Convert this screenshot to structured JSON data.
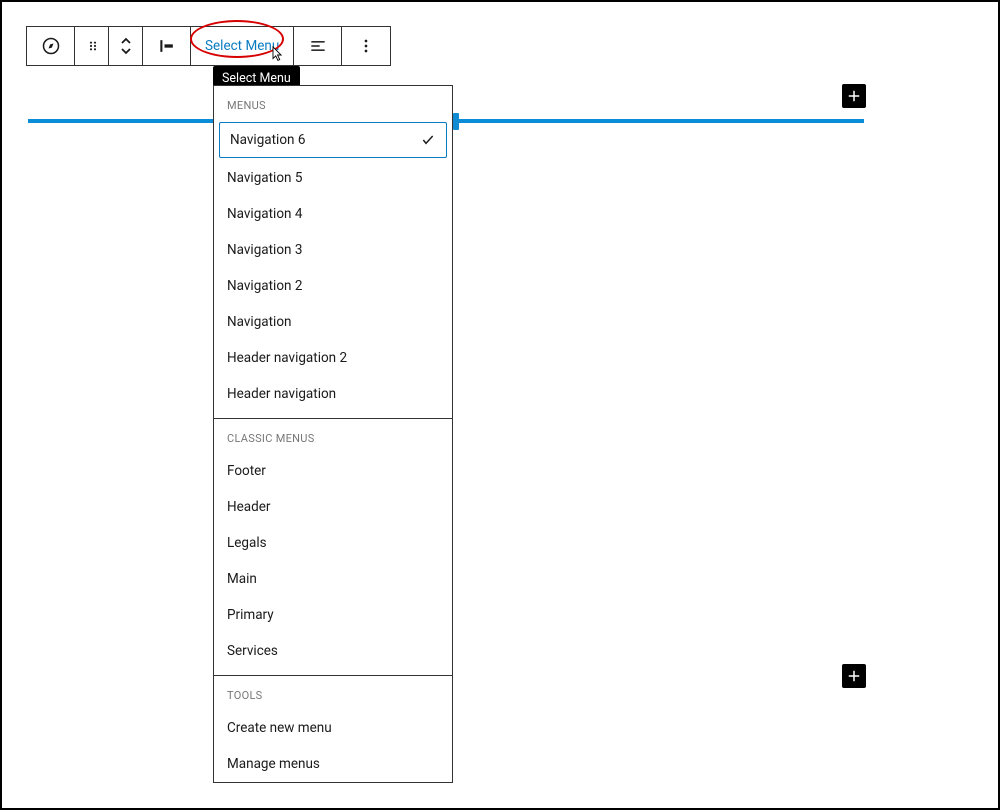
{
  "toolbar": {
    "select_menu_label": "Select Menu"
  },
  "tooltip": {
    "text": "Select Menu"
  },
  "dropdown": {
    "sections": {
      "menus": {
        "header": "MENUS",
        "items": [
          {
            "label": "Navigation 6",
            "selected": true
          },
          {
            "label": "Navigation 5",
            "selected": false
          },
          {
            "label": "Navigation 4",
            "selected": false
          },
          {
            "label": "Navigation 3",
            "selected": false
          },
          {
            "label": "Navigation 2",
            "selected": false
          },
          {
            "label": "Navigation",
            "selected": false
          },
          {
            "label": "Header navigation 2",
            "selected": false
          },
          {
            "label": "Header navigation",
            "selected": false
          }
        ]
      },
      "classic_menus": {
        "header": "CLASSIC MENUS",
        "items": [
          {
            "label": "Footer"
          },
          {
            "label": "Header"
          },
          {
            "label": "Legals"
          },
          {
            "label": "Main"
          },
          {
            "label": "Primary"
          },
          {
            "label": "Services"
          }
        ]
      },
      "tools": {
        "header": "TOOLS",
        "items": [
          {
            "label": "Create new menu"
          },
          {
            "label": "Manage menus"
          }
        ]
      }
    }
  },
  "colors": {
    "accent": "#0a7bc1",
    "highlight_red": "#d60000",
    "line_blue": "#0a8dd6"
  }
}
